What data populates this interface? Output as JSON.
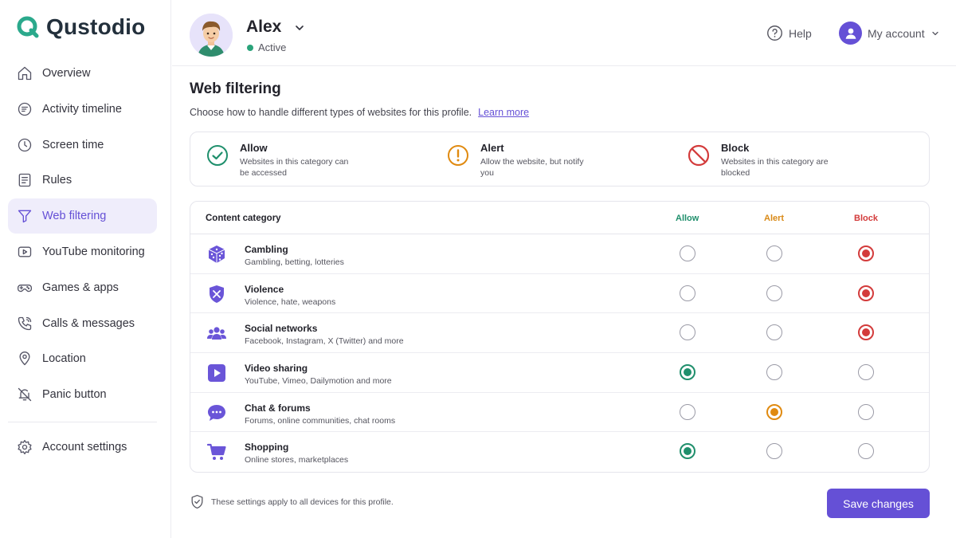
{
  "app": {
    "name": "Qustodio",
    "brand_color": "#2ba98c",
    "accent_color": "#6550d6"
  },
  "sidebar": {
    "items": [
      {
        "label": "Overview",
        "icon": "home-icon"
      },
      {
        "label": "Activity timeline",
        "icon": "timeline-icon"
      },
      {
        "label": "Screen time",
        "icon": "clock-icon"
      },
      {
        "label": "Rules",
        "icon": "list-icon"
      },
      {
        "label": "Web filtering",
        "icon": "filter-icon",
        "active": true
      },
      {
        "label": "YouTube monitoring",
        "icon": "youtube-icon"
      },
      {
        "label": "Games & apps",
        "icon": "gamepad-icon"
      },
      {
        "label": "Calls & messages",
        "icon": "phone-icon"
      },
      {
        "label": "Location",
        "icon": "location-pin-icon"
      },
      {
        "label": "Panic button",
        "icon": "bell-off-icon"
      }
    ],
    "bottom": {
      "label": "Account settings",
      "icon": "gear-icon"
    }
  },
  "header": {
    "profile_name": "Alex",
    "status": "Active",
    "help_label": "Help",
    "account_label": "My account"
  },
  "main": {
    "title": "Web filtering",
    "subtitle": "Choose how to handle different types of websites for this profile.",
    "learn_more": "Learn more",
    "legend": {
      "allow": {
        "title": "Allow",
        "desc": "Websites in this category can be accessed"
      },
      "alert": {
        "title": "Alert",
        "desc": "Allow the website, but notify you"
      },
      "block": {
        "title": "Block",
        "desc": "Websites in this category are blocked"
      }
    },
    "table": {
      "headers": {
        "category": "Content category",
        "allow": "Allow",
        "alert": "Alert",
        "block": "Block"
      },
      "rows": [
        {
          "name": "Cambling",
          "desc": "Gambling, betting, lotteries",
          "icon": "dice-icon",
          "selected": "block"
        },
        {
          "name": "Violence",
          "desc": "Violence, hate, weapons",
          "icon": "shield-swords-icon",
          "selected": "block"
        },
        {
          "name": "Social networks",
          "desc": "Facebook, Instagram, X (Twitter) and more",
          "icon": "people-icon",
          "selected": "block"
        },
        {
          "name": "Video sharing",
          "desc": "YouTube, Vimeo, Dailymotion and more",
          "icon": "play-icon",
          "selected": "allow"
        },
        {
          "name": "Chat & forums",
          "desc": "Forums, online communities, chat rooms",
          "icon": "chat-bubble-icon",
          "selected": "alert"
        },
        {
          "name": "Shopping",
          "desc": "Online stores, marketplaces",
          "icon": "cart-icon",
          "selected": "allow"
        }
      ]
    },
    "footnote": "These settings apply to all devices for this profile.",
    "save_label": "Save changes"
  }
}
